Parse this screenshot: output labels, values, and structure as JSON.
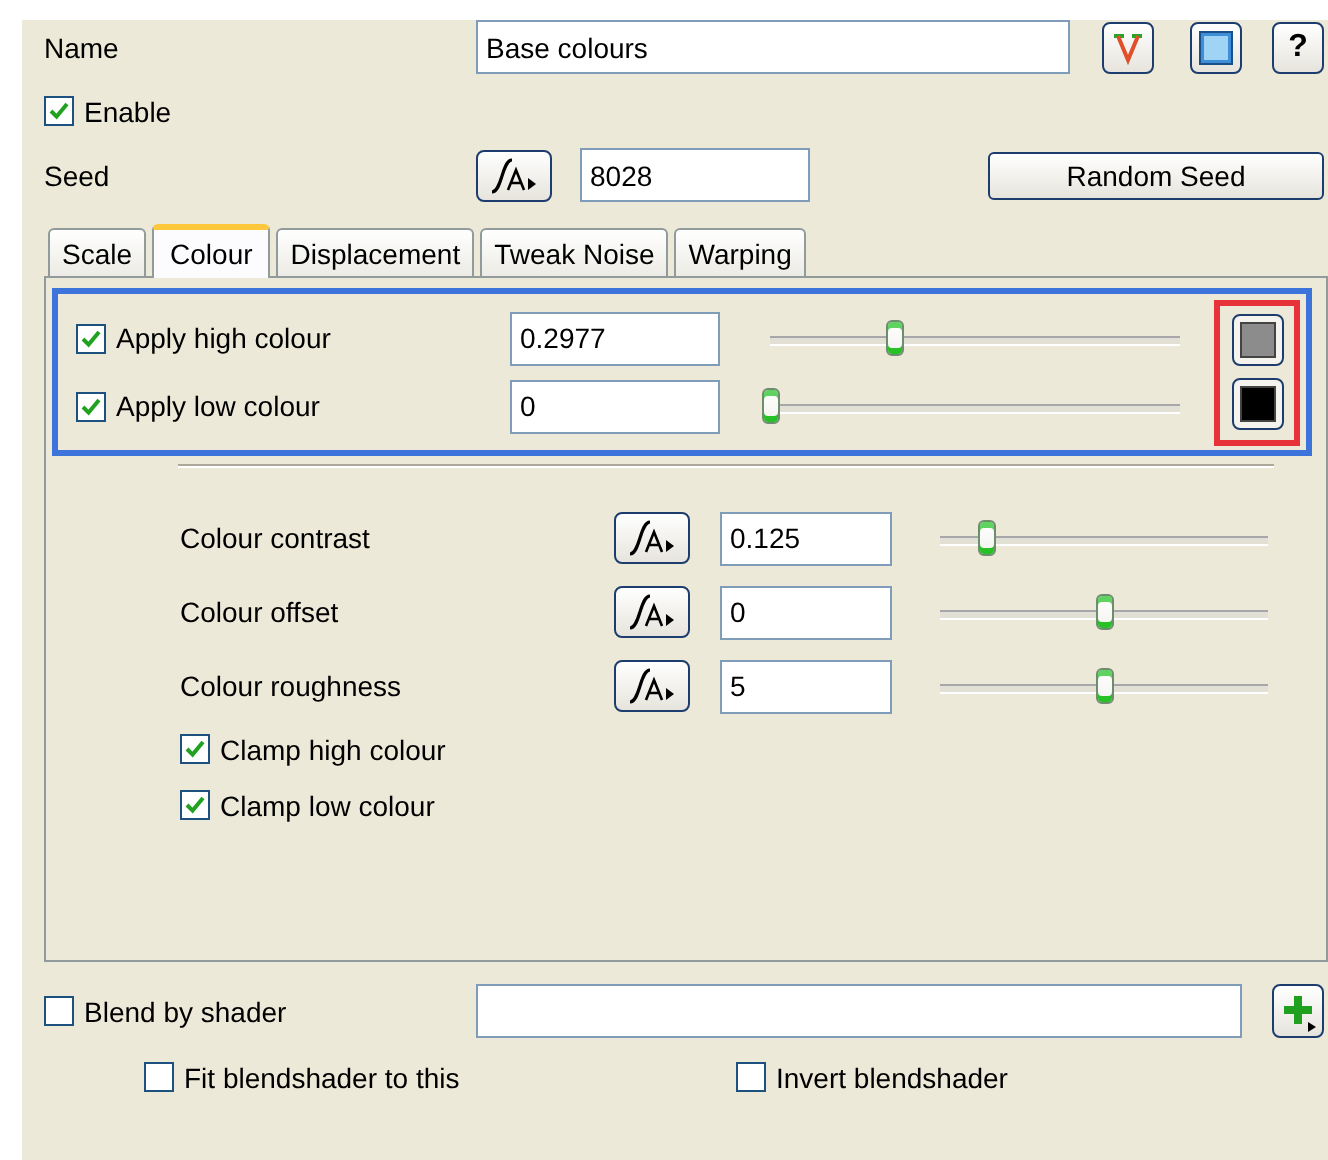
{
  "name": {
    "label": "Name",
    "value": "Base colours"
  },
  "help_button": {
    "label": "?"
  },
  "enable": {
    "label": "Enable",
    "checked": true
  },
  "seed": {
    "label": "Seed",
    "value": "8028",
    "button": "Random Seed"
  },
  "tabs": [
    {
      "label": "Scale",
      "selected": false
    },
    {
      "label": "Colour",
      "selected": true
    },
    {
      "label": "Displacement",
      "selected": false
    },
    {
      "label": "Tweak Noise",
      "selected": false
    },
    {
      "label": "Warping",
      "selected": false
    }
  ],
  "colour_rows": [
    {
      "label": "Apply high colour",
      "checked": true,
      "value": "0.2977",
      "level": 0.3,
      "color": "#8c8c8c"
    },
    {
      "label": "Apply low colour",
      "checked": true,
      "value": "0",
      "level": 0,
      "color": "#000000"
    }
  ],
  "parameters": [
    {
      "label": "Colour contrast",
      "value": "0.125",
      "level": 0.14
    },
    {
      "label": "Colour offset",
      "value": "0",
      "level": 0.5
    },
    {
      "label": "Colour roughness",
      "value": "5",
      "level": 0.5
    }
  ],
  "clamps": [
    {
      "label": "Clamp high colour",
      "checked": true
    },
    {
      "label": "Clamp low colour",
      "checked": true
    }
  ],
  "blend": {
    "label": "Blend by shader",
    "checked": false
  },
  "blend_options": [
    {
      "label": "Fit blendshader to this",
      "checked": false
    },
    {
      "label": "Invert blendshader",
      "checked": false
    }
  ]
}
